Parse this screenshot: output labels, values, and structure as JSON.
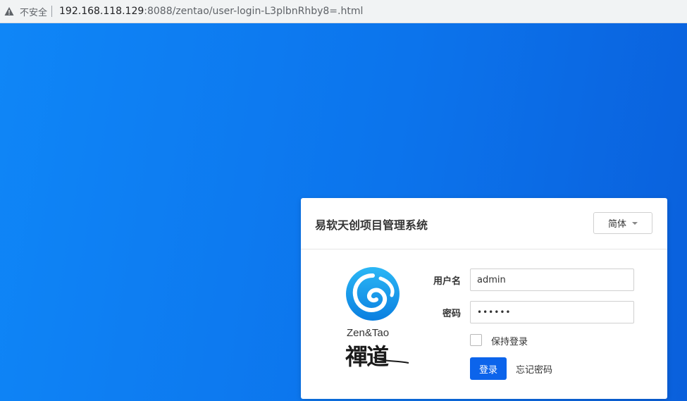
{
  "browser": {
    "security_label": "不安全",
    "url_host": "192.168.118.129",
    "url_rest": ":8088/zentao/user-login-L3plbnRhby8=.html"
  },
  "login": {
    "title": "易软天创项目管理系统",
    "language": "简体",
    "logo_text": "Zen&Tao",
    "logo_cn": "禪道",
    "username_label": "用户名",
    "username_value": "admin",
    "password_label": "密码",
    "password_masked": "••••••",
    "keep_login_label": "保持登录",
    "keep_login_checked": false,
    "login_button": "登录",
    "forgot_password": "忘记密码"
  },
  "colors": {
    "accent": "#0c64eb",
    "background_left": "#0f86f7",
    "background_right": "#0a60dc"
  }
}
